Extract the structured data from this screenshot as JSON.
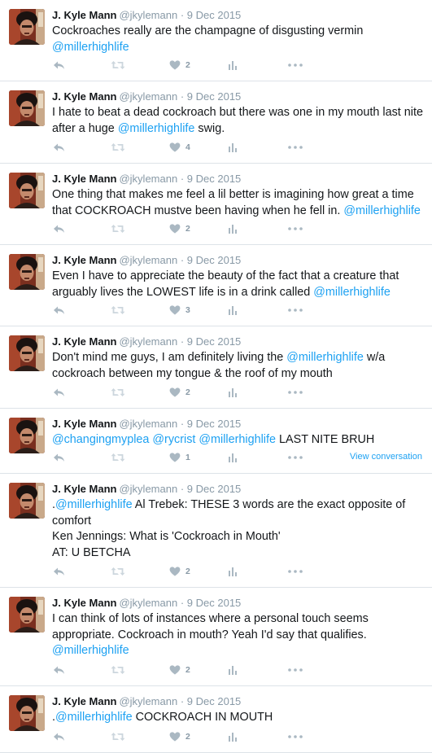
{
  "tweets": [
    {
      "author": "J. Kyle Mann",
      "handle": "@jkylemann",
      "date": "9 Dec 2015",
      "lines": [
        [
          {
            "t": "Cockroaches really are the champagne of disgusting vermin "
          },
          {
            "t": "@millerhighlife",
            "m": true
          }
        ]
      ],
      "likes": "2",
      "view_conversation": ""
    },
    {
      "author": "J. Kyle Mann",
      "handle": "@jkylemann",
      "date": "9 Dec 2015",
      "lines": [
        [
          {
            "t": "I hate to beat a dead cockroach but there was one in my mouth last nite after a huge "
          },
          {
            "t": "@millerhighlife",
            "m": true
          },
          {
            "t": " swig."
          }
        ]
      ],
      "likes": "4",
      "view_conversation": ""
    },
    {
      "author": "J. Kyle Mann",
      "handle": "@jkylemann",
      "date": "9 Dec 2015",
      "lines": [
        [
          {
            "t": "One thing that makes me feel a lil better is imagining how great a time that COCKROACH mustve been having when he fell in. "
          },
          {
            "t": "@millerhighlife",
            "m": true
          }
        ]
      ],
      "likes": "2",
      "view_conversation": ""
    },
    {
      "author": "J. Kyle Mann",
      "handle": "@jkylemann",
      "date": "9 Dec 2015",
      "lines": [
        [
          {
            "t": "Even I have to appreciate the beauty of the fact that a creature that arguably lives the LOWEST life is in a drink called "
          },
          {
            "t": "@millerhighlife",
            "m": true
          }
        ]
      ],
      "likes": "3",
      "view_conversation": ""
    },
    {
      "author": "J. Kyle Mann",
      "handle": "@jkylemann",
      "date": "9 Dec 2015",
      "lines": [
        [
          {
            "t": "Don't mind me guys, I am definitely living the "
          },
          {
            "t": "@millerhighlife",
            "m": true
          },
          {
            "t": " w/a cockroach between my tongue & the roof of my mouth"
          }
        ]
      ],
      "likes": "2",
      "view_conversation": ""
    },
    {
      "author": "J. Kyle Mann",
      "handle": "@jkylemann",
      "date": "9 Dec 2015",
      "lines": [
        [
          {
            "t": "@changingmyplea",
            "m": true
          },
          {
            "t": " "
          },
          {
            "t": "@rycrist",
            "m": true
          },
          {
            "t": " "
          },
          {
            "t": "@millerhighlife",
            "m": true
          },
          {
            "t": " LAST NITE BRUH"
          }
        ]
      ],
      "likes": "1",
      "view_conversation": "View conversation"
    },
    {
      "author": "J. Kyle Mann",
      "handle": "@jkylemann",
      "date": "9 Dec 2015",
      "lines": [
        [
          {
            "t": "."
          },
          {
            "t": "@millerhighlife",
            "m": true
          },
          {
            "t": " Al Trebek: THESE 3 words are the exact opposite of comfort"
          }
        ],
        [
          {
            "t": "Ken Jennings: What is 'Cockroach in Mouth'"
          }
        ],
        [
          {
            "t": "AT: U BETCHA"
          }
        ]
      ],
      "likes": "2",
      "view_conversation": ""
    },
    {
      "author": "J. Kyle Mann",
      "handle": "@jkylemann",
      "date": "9 Dec 2015",
      "lines": [
        [
          {
            "t": "I can think of lots of instances where a personal touch seems appropriate. Cockroach in mouth? Yeah I'd say that qualifies. "
          },
          {
            "t": "@millerhighlife",
            "m": true
          }
        ]
      ],
      "likes": "2",
      "view_conversation": ""
    },
    {
      "author": "J. Kyle Mann",
      "handle": "@jkylemann",
      "date": "9 Dec 2015",
      "lines": [
        [
          {
            "t": "."
          },
          {
            "t": "@millerhighlife",
            "m": true
          },
          {
            "t": " COCKROACH IN MOUTH"
          }
        ]
      ],
      "likes": "2",
      "view_conversation": ""
    }
  ],
  "colors": {
    "mention": "#1da1f2",
    "text": "#14171a",
    "meta": "#8899a6",
    "icon": "#aab8c2"
  },
  "icons": [
    "reply-icon",
    "retweet-icon",
    "heart-icon",
    "analytics-icon",
    "more-icon"
  ]
}
